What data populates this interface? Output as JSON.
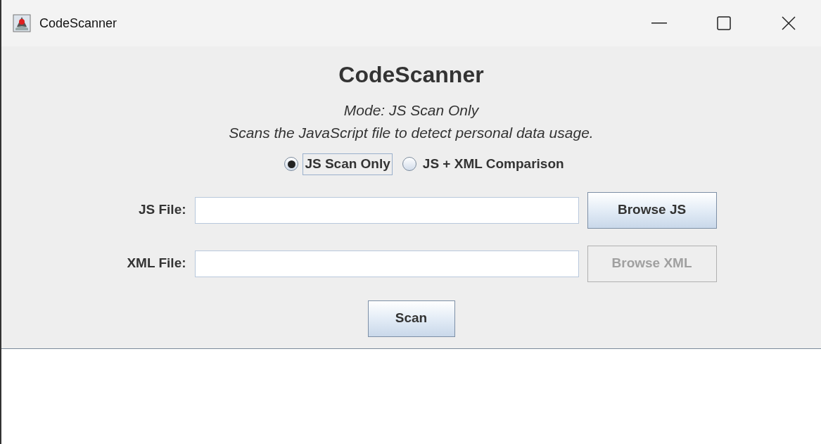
{
  "window": {
    "title": "CodeScanner"
  },
  "heading": "CodeScanner",
  "mode_line": "Mode: JS Scan Only",
  "description": "Scans the JavaScript file to detect personal data usage.",
  "modes": [
    {
      "label": "JS Scan Only",
      "selected": true,
      "focused": true
    },
    {
      "label": "JS + XML Comparison",
      "selected": false,
      "focused": false
    }
  ],
  "fields": [
    {
      "label": "JS File:",
      "button": "Browse JS",
      "disabled": false
    },
    {
      "label": "XML File:",
      "button": "Browse XML",
      "disabled": true
    }
  ],
  "scan_button": "Scan"
}
